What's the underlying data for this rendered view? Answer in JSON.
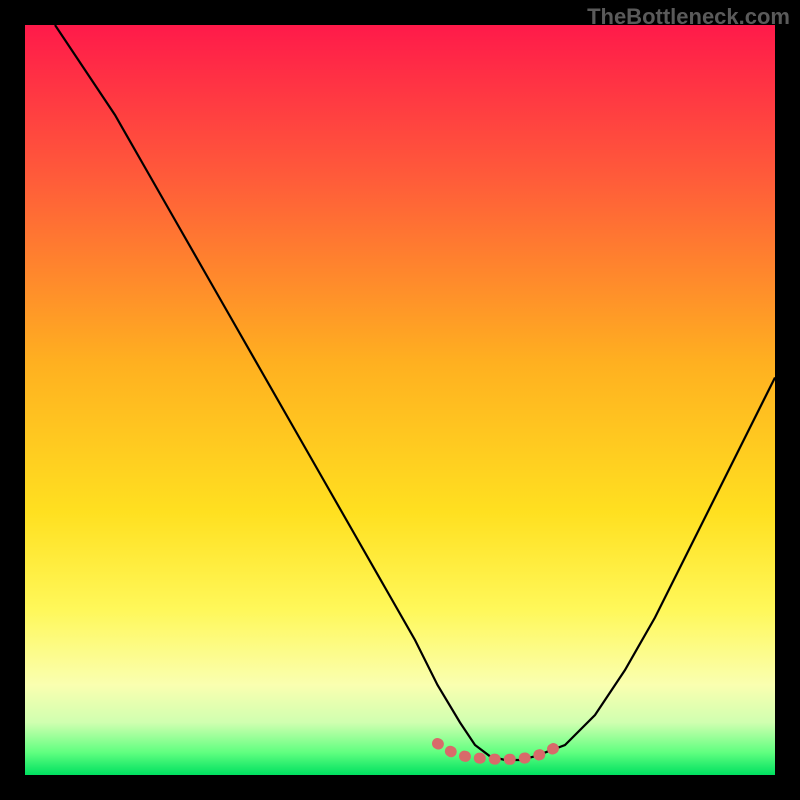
{
  "watermark": "TheBottleneck.com",
  "chart_data": {
    "type": "line",
    "title": "",
    "xlabel": "",
    "ylabel": "",
    "xlim": [
      0,
      100
    ],
    "ylim": [
      0,
      100
    ],
    "background_gradient": {
      "stops": [
        {
          "offset": 0,
          "color": "#ff1a4a"
        },
        {
          "offset": 20,
          "color": "#ff5a3a"
        },
        {
          "offset": 45,
          "color": "#ffb020"
        },
        {
          "offset": 65,
          "color": "#ffe020"
        },
        {
          "offset": 78,
          "color": "#fff85a"
        },
        {
          "offset": 88,
          "color": "#faffb0"
        },
        {
          "offset": 93,
          "color": "#d0ffb0"
        },
        {
          "offset": 97,
          "color": "#60ff80"
        },
        {
          "offset": 100,
          "color": "#00e060"
        }
      ]
    },
    "series": [
      {
        "name": "bottleneck-curve",
        "color": "#000000",
        "x": [
          4,
          8,
          12,
          16,
          20,
          24,
          28,
          32,
          36,
          40,
          44,
          48,
          52,
          55,
          58,
          60,
          62,
          64,
          66,
          68,
          72,
          76,
          80,
          84,
          88,
          92,
          96,
          100
        ],
        "y": [
          100,
          94,
          88,
          81,
          74,
          67,
          60,
          53,
          46,
          39,
          32,
          25,
          18,
          12,
          7,
          4,
          2.5,
          2,
          2,
          2.5,
          4,
          8,
          14,
          21,
          29,
          37,
          45,
          53
        ]
      }
    ],
    "highlight_segment": {
      "name": "optimal-zone",
      "color": "#d86a6a",
      "x": [
        55,
        57,
        59,
        61,
        63,
        65,
        67,
        69,
        71
      ],
      "y": [
        4.2,
        3.0,
        2.4,
        2.2,
        2.1,
        2.1,
        2.3,
        2.8,
        3.8
      ]
    }
  }
}
